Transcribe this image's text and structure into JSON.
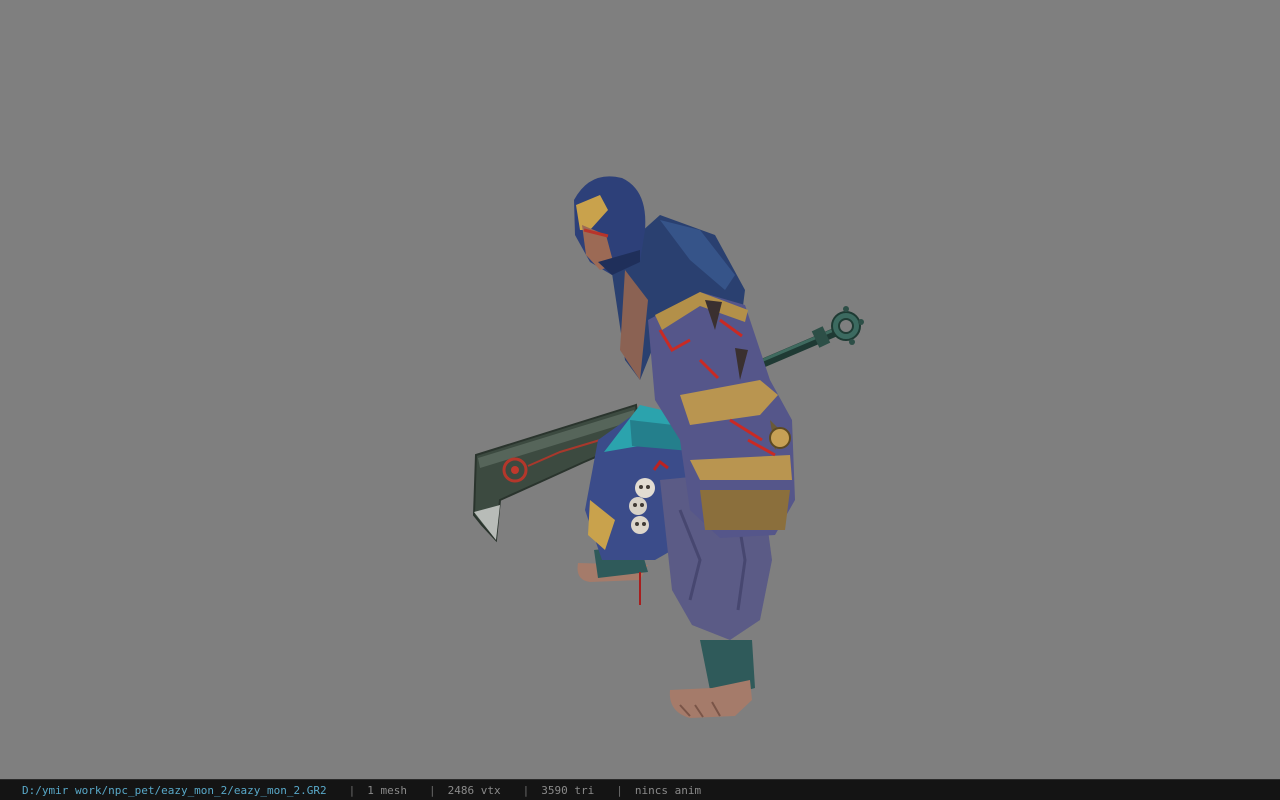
{
  "viewport": {
    "background": "#7f7f7f",
    "model_name": "eazy_mon_2"
  },
  "statusbar": {
    "file_path": "D:/ymir work/npc_pet/eazy_mon_2/eazy_mon_2.GR2",
    "separator": "|",
    "mesh_count": "1 mesh",
    "vertex_count": "2486 vtx",
    "triangle_count": "3590 tri",
    "anim_status": "nincs anim",
    "path_color": "#58a8c8"
  }
}
